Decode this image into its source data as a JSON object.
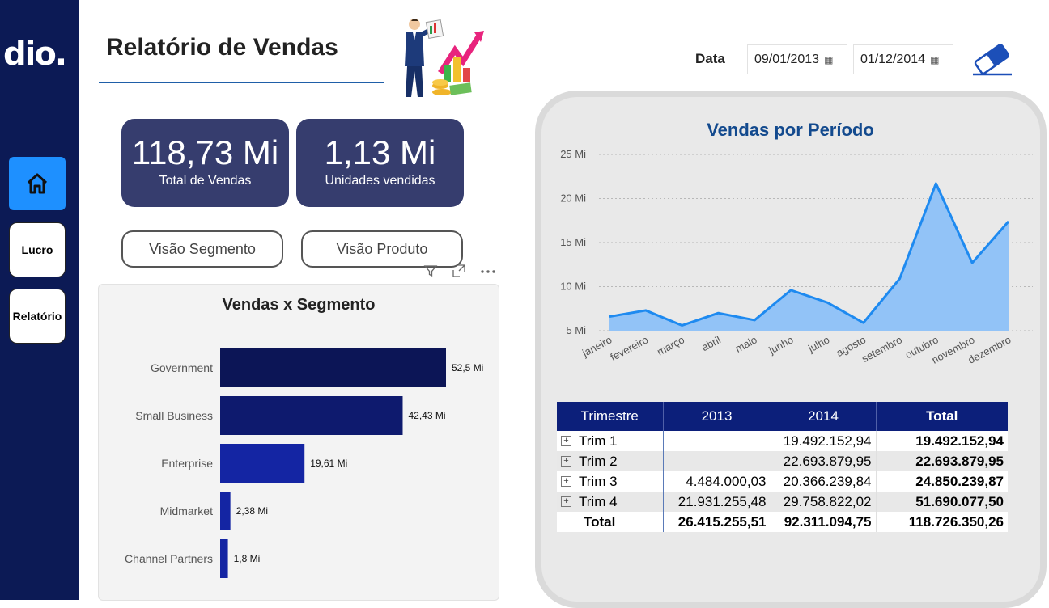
{
  "brand": {
    "logo": "dio."
  },
  "sidebar": {
    "items": [
      {
        "label": "Lucro"
      },
      {
        "label": "Relatório"
      }
    ]
  },
  "header": {
    "title": "Relatório de Vendas"
  },
  "kpis": [
    {
      "value": "118,73 Mi",
      "label": "Total de Vendas"
    },
    {
      "value": "1,13 Mi",
      "label": "Unidades vendidas"
    }
  ],
  "buttons": {
    "segment": "Visão Segmento",
    "product": "Visão Produto"
  },
  "date_filter": {
    "label": "Data",
    "start": "09/01/2013",
    "end": "01/12/2014"
  },
  "colors": {
    "sidebar": "#0c1a55",
    "kpi": "#363d6e",
    "accent": "#1e90ff",
    "area_line": "#1e8af0",
    "area_fill": "#92c3f7",
    "table_header": "#0c1f7a"
  },
  "segment_chart": {
    "title": "Vendas x Segmento",
    "chart_data": {
      "type": "bar",
      "orientation": "horizontal",
      "categories": [
        "Government",
        "Small Business",
        "Enterprise",
        "Midmarket",
        "Channel Partners"
      ],
      "values": [
        52.5,
        42.43,
        19.61,
        2.38,
        1.8
      ],
      "value_labels": [
        "52,5 Mi",
        "42,43 Mi",
        "19,61 Mi",
        "2,38 Mi",
        "1,8 Mi"
      ],
      "bar_colors": [
        "#0c1556",
        "#0e1a6e",
        "#1425a3",
        "#1425a3",
        "#1425a3"
      ]
    }
  },
  "period_chart": {
    "title": "Vendas por Período",
    "chart_data": {
      "type": "area",
      "categories": [
        "janeiro",
        "fevereiro",
        "março",
        "abril",
        "maio",
        "junho",
        "julho",
        "agosto",
        "setembro",
        "outubro",
        "novembro",
        "dezembro"
      ],
      "values": [
        6.6,
        7.3,
        5.6,
        7.0,
        6.2,
        9.6,
        8.2,
        5.9,
        10.9,
        21.7,
        12.7,
        17.4
      ],
      "unit": "Mi",
      "ylim": [
        5,
        25
      ],
      "yticks": [
        5,
        10,
        15,
        20,
        25
      ],
      "ytick_labels": [
        "5 Mi",
        "10 Mi",
        "15 Mi",
        "20 Mi",
        "25 Mi"
      ],
      "grid": true
    }
  },
  "table": {
    "headers": [
      "Trimestre",
      "2013",
      "2014",
      "Total"
    ],
    "rows": [
      [
        "Trim 1",
        "",
        "19.492.152,94",
        "19.492.152,94"
      ],
      [
        "Trim 2",
        "",
        "22.693.879,95",
        "22.693.879,95"
      ],
      [
        "Trim 3",
        "4.484.000,03",
        "20.366.239,84",
        "24.850.239,87"
      ],
      [
        "Trim 4",
        "21.931.255,48",
        "29.758.822,02",
        "51.690.077,50"
      ]
    ],
    "total": [
      "Total",
      "26.415.255,51",
      "92.311.094,75",
      "118.726.350,26"
    ]
  }
}
